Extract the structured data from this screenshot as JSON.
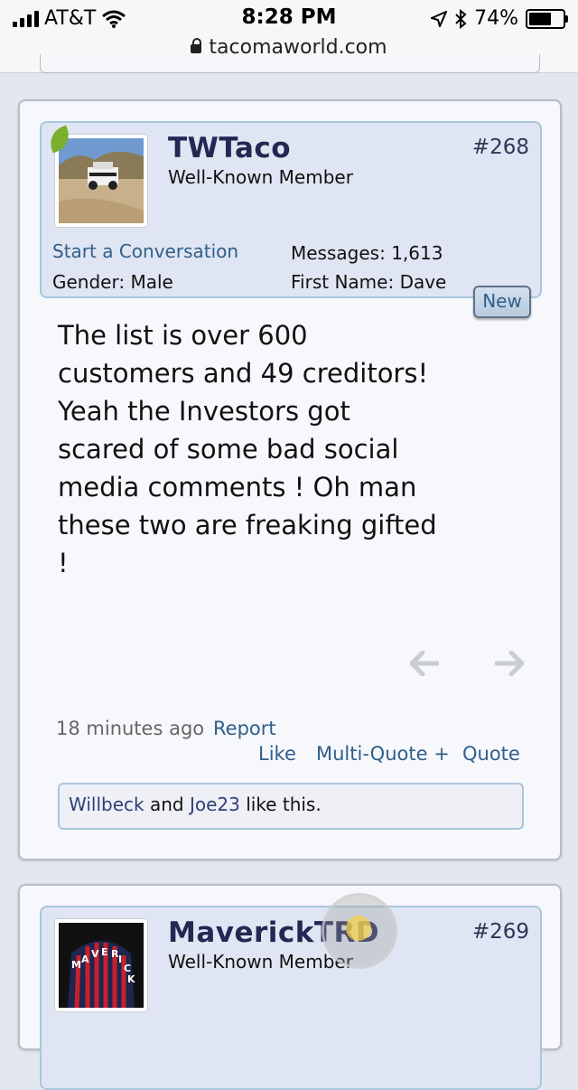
{
  "status_bar": {
    "carrier": "AT&T",
    "time": "8:28 PM",
    "battery": "74%",
    "battery_level": 0.74,
    "url": "tacomaworld.com"
  },
  "posts": [
    {
      "username": "TWTaco",
      "user_title": "Well-Known Member",
      "post_number": "#268",
      "start_conversation": "Start a Conversation",
      "gender_label": "Gender:",
      "gender_value": "Male",
      "messages_label": "Messages:",
      "messages_value": "1,613",
      "first_name_label": "First Name:",
      "first_name_value": "Dave",
      "new_badge": "New",
      "message_lines": [
        "The list is over 600",
        "customers and 49 creditors!",
        "Yeah the Investors got",
        "scared of some bad social",
        "media comments ! Oh man",
        "these two are freaking gifted",
        "!"
      ],
      "timestamp": "18 minutes ago",
      "report": "Report",
      "like": "Like",
      "multi_quote": "Multi-Quote +",
      "quote": "Quote",
      "liked_by": [
        "Willbeck",
        "Joe23"
      ],
      "likes_and": "and",
      "likes_suffix": "like this."
    },
    {
      "username": "MaverickTRD",
      "user_title": "Well-Known Member",
      "post_number": "#269",
      "avatar_letters": [
        "M",
        "A",
        "V",
        "E",
        "R",
        "I",
        "C",
        "K"
      ]
    }
  ],
  "colors": {
    "username": "#232753",
    "link": "#2f5f8a",
    "user_box_bg": "#dfe5f2",
    "user_box_border": "#a9c6df",
    "online_badge": "#7ab02c"
  },
  "icons": {
    "signal": "signal-bars-icon",
    "wifi": "wifi-icon",
    "location": "location-arrow-icon",
    "bluetooth": "bluetooth-icon",
    "battery": "battery-icon",
    "lock": "lock-icon",
    "prev": "arrow-left-icon",
    "next": "arrow-right-icon"
  }
}
